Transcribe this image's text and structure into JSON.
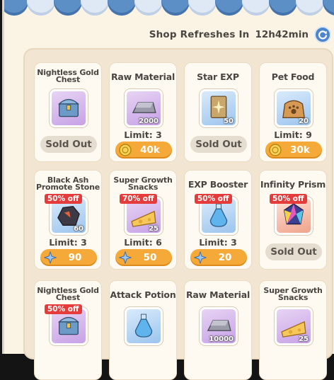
{
  "header": {
    "refresh_label": "Shop Refreshes In",
    "refresh_time": "12h42min"
  },
  "colors": {
    "price_button": "#f5a939",
    "discount_badge": "#e63b3b",
    "rarity_purple": "#c7a1e6",
    "rarity_blue": "#9cc4ee",
    "rarity_red": "#f0a38b"
  },
  "items": [
    {
      "name": "Nightless Gold Chest",
      "icon": "chest-icon",
      "rarity": "purple",
      "qty": "",
      "badge": "",
      "limit": "",
      "price": "",
      "currency": "",
      "sold": "Sold Out"
    },
    {
      "name": "Raw Material",
      "icon": "ingot-icon",
      "rarity": "purple",
      "qty": "2000",
      "badge": "",
      "limit": "Limit: 3",
      "price": "40k",
      "currency": "gold-coin-icon",
      "sold": ""
    },
    {
      "name": "Star EXP",
      "icon": "star-card-icon",
      "rarity": "blue",
      "qty": "50",
      "badge": "",
      "limit": "",
      "price": "",
      "currency": "",
      "sold": "Sold Out"
    },
    {
      "name": "Pet Food",
      "icon": "food-bag-icon",
      "rarity": "blue",
      "qty": "20",
      "badge": "",
      "limit": "Limit: 9",
      "price": "30k",
      "currency": "gold-coin-icon",
      "sold": ""
    },
    {
      "name": "Black Ash Promote Stone",
      "icon": "stone-icon",
      "rarity": "blue",
      "qty": "60",
      "badge": "50% off",
      "limit": "Limit: 3",
      "price": "90",
      "currency": "star-gem-icon",
      "sold": ""
    },
    {
      "name": "Super Growth Snacks",
      "icon": "cheese-icon",
      "rarity": "purple",
      "qty": "25",
      "badge": "70% off",
      "limit": "Limit: 6",
      "price": "50",
      "currency": "star-gem-icon",
      "sold": ""
    },
    {
      "name": "EXP Booster",
      "icon": "potion-icon",
      "rarity": "blue",
      "qty": "",
      "badge": "50% off",
      "limit": "Limit: 3",
      "price": "20",
      "currency": "star-gem-icon",
      "sold": ""
    },
    {
      "name": "Infinity Prism",
      "icon": "prism-icon",
      "rarity": "red",
      "qty": "",
      "badge": "50% off",
      "limit": "",
      "price": "",
      "currency": "",
      "sold": "Sold Out"
    },
    {
      "name": "Nightless Gold Chest",
      "icon": "chest-icon",
      "rarity": "purple",
      "qty": "",
      "badge": "50% off",
      "limit": "",
      "price": "",
      "currency": "",
      "sold": ""
    },
    {
      "name": "Attack Potion",
      "icon": "potion-icon",
      "rarity": "blue",
      "qty": "",
      "badge": "",
      "limit": "",
      "price": "",
      "currency": "",
      "sold": ""
    },
    {
      "name": "Raw Material",
      "icon": "ingot-icon",
      "rarity": "purple",
      "qty": "10000",
      "badge": "",
      "limit": "",
      "price": "",
      "currency": "",
      "sold": ""
    },
    {
      "name": "Super Growth Snacks",
      "icon": "cheese-icon",
      "rarity": "purple",
      "qty": "25",
      "badge": "",
      "limit": "",
      "price": "",
      "currency": "",
      "sold": ""
    }
  ]
}
